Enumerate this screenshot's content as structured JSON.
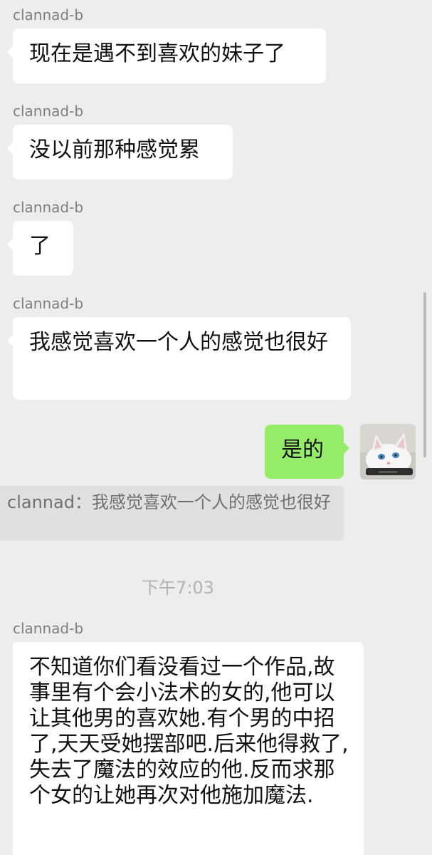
{
  "messages": [
    {
      "sender": "clannad-b",
      "text": "现在是遇不到喜欢的妹子了"
    },
    {
      "sender": "clannad-b",
      "text": "没以前那种感觉累"
    },
    {
      "sender": "clannad-b",
      "text": "了"
    },
    {
      "sender": "clannad-b",
      "text": "我感觉喜欢一个人的感觉也很好"
    },
    {
      "text": "是的"
    },
    {
      "sender": "clannad-b",
      "text": "不知道你们看没看过一个作品,故事里有个会小法术的女的,他可以让其他男的喜欢她.有个男的中招了,天天受她摆部吧.后来他得救了,失去了魔法的效应的他.反而求那个女的让她再次对他施加魔法."
    }
  ],
  "quote": {
    "text": "clannad：我感觉喜欢一个人的感觉也很好"
  },
  "timestamp": "下午7:03",
  "avatar": {
    "icon": "white-cat-avatar"
  },
  "colors": {
    "background": "#ededed",
    "incoming_bubble": "#ffffff",
    "outgoing_bubble": "#95ec69",
    "quote_background": "#e0e0e0"
  }
}
